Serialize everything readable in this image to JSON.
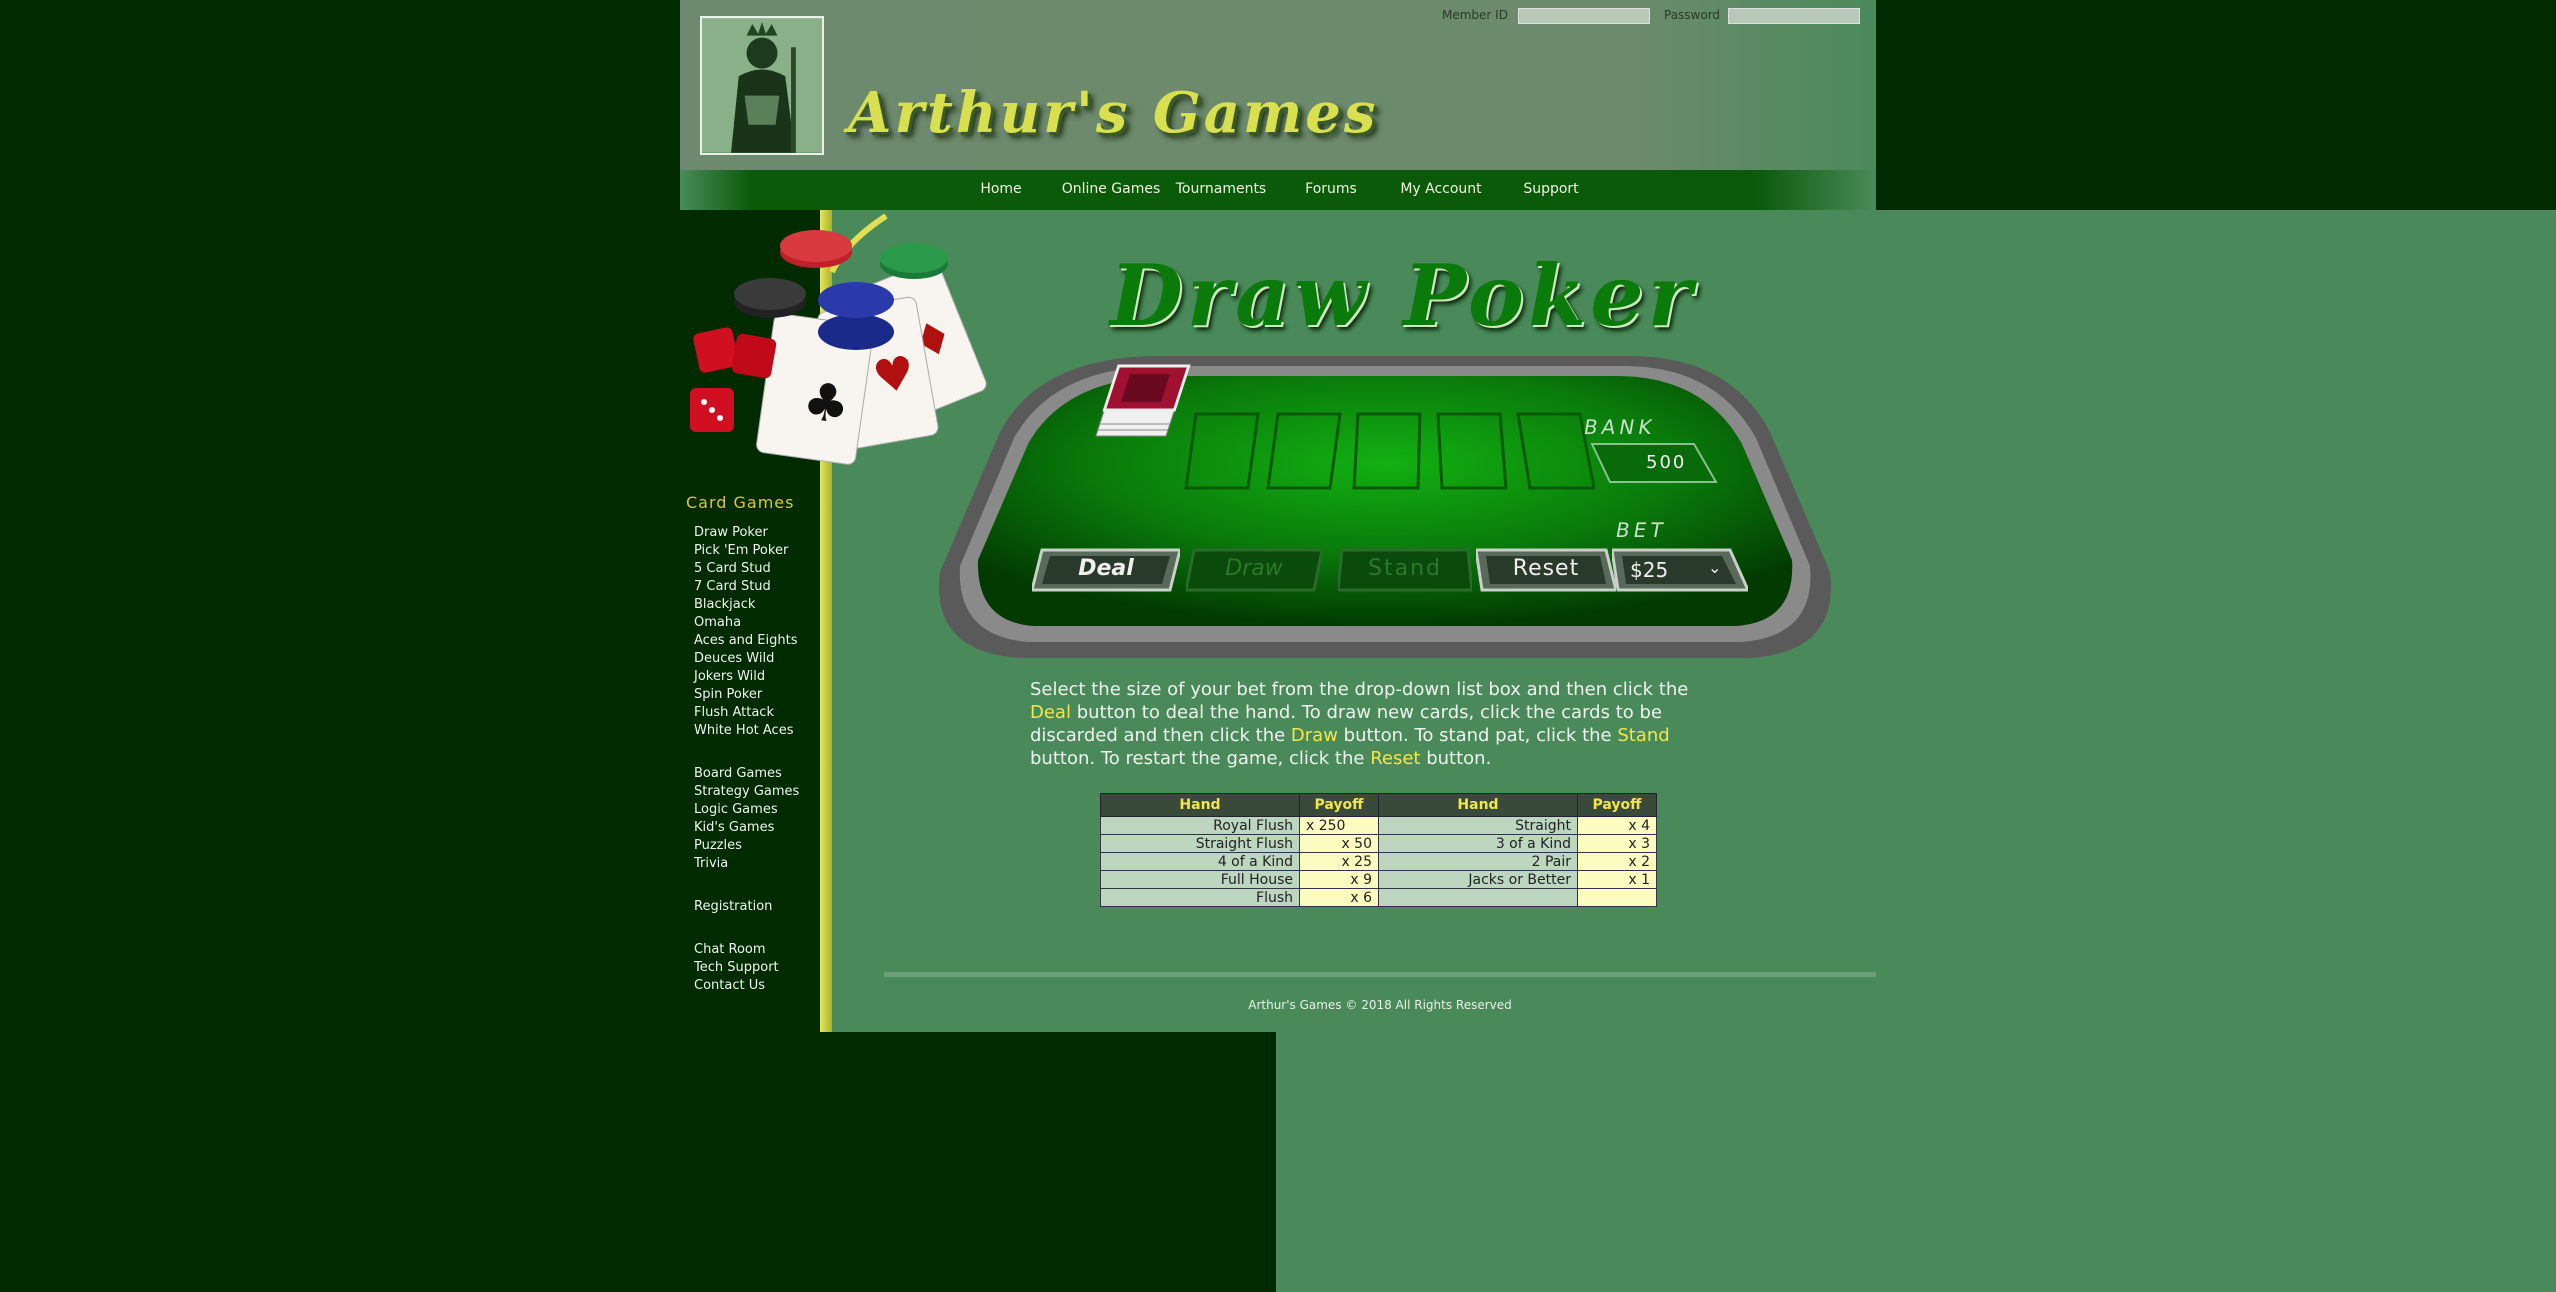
{
  "header": {
    "brand": "Arthur's Games",
    "login": {
      "member_id_label": "Member ID",
      "password_label": "Password",
      "member_id_value": "",
      "password_value": ""
    }
  },
  "nav": [
    "Home",
    "Online Games",
    "Tournaments",
    "Forums",
    "My Account",
    "Support"
  ],
  "sidebar": {
    "title": "Card Games",
    "card_games": [
      "Draw Poker",
      "Pick 'Em Poker",
      "5 Card Stud",
      "7 Card Stud",
      "Blackjack",
      "Omaha",
      "Aces and Eights",
      "Deuces Wild",
      "Jokers Wild",
      "Spin Poker",
      "Flush Attack",
      "White Hot Aces"
    ],
    "other_games": [
      "Board Games",
      "Strategy Games",
      "Logic Games",
      "Kid's Games",
      "Puzzles",
      "Trivia"
    ],
    "registration": "Registration",
    "support": [
      "Chat Room",
      "Tech Support",
      "Contact Us"
    ]
  },
  "game": {
    "title": "Draw Poker",
    "bank_label": "BANK",
    "bank_value": "500",
    "bet_label": "BET",
    "bet_value": "$25",
    "buttons": {
      "deal": "Deal",
      "draw": "Draw",
      "stand": "Stand",
      "reset": "Reset"
    }
  },
  "instructions": {
    "p1": "Select the size of your bet from the drop-down list box and then click the ",
    "deal": "Deal",
    "p2": " button to deal the hand. To draw new cards, click the cards to be discarded and then click the ",
    "draw": "Draw",
    "p3": " button. To stand pat, click the ",
    "stand": "Stand",
    "p4": " button. To restart the game, click the ",
    "reset": "Reset",
    "p5": " button."
  },
  "payoffs": {
    "headers": [
      "Hand",
      "Payoff",
      "Hand",
      "Payoff"
    ],
    "rows": [
      [
        "Royal Flush",
        "x 250",
        "Straight",
        "x 4"
      ],
      [
        "Straight Flush",
        "x 50",
        "3 of a Kind",
        "x 3"
      ],
      [
        "4 of a Kind",
        "x 25",
        "2 Pair",
        "x 2"
      ],
      [
        "Full House",
        "x 9",
        "Jacks or Better",
        "x 1"
      ],
      [
        "Flush",
        "x 6",
        "",
        ""
      ]
    ]
  },
  "footer": "Arthur's Games © 2018 All Rights Reserved",
  "colors": {
    "accent": "#f2e64a",
    "felt": "#0a8a0a",
    "page": "#4a8a5a",
    "dark": "#002a00"
  }
}
